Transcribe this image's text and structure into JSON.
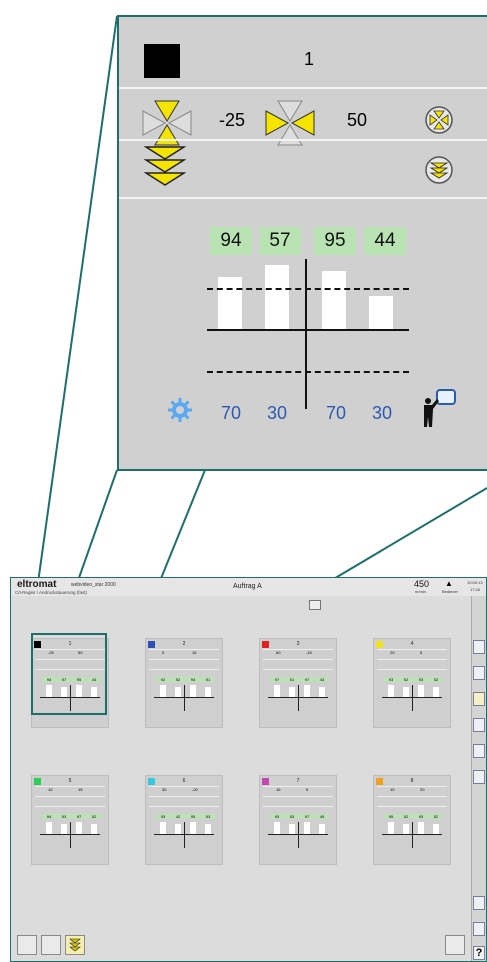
{
  "zoom": {
    "position_label": "1",
    "swatch_color": "#000000",
    "inlet": {
      "value_a": "-25",
      "value_b": "50"
    },
    "readings": [
      "94",
      "57",
      "95",
      "44"
    ],
    "bar_levels": [
      0.52,
      0.64,
      0.58,
      0.33
    ],
    "bottom_values": [
      "70",
      "30",
      "70",
      "30"
    ],
    "icons": [
      "valve-yellow-icon",
      "valve-pair-icon",
      "circle-valve-icon",
      "stacked-chevrons-icon",
      "circle-chevrons-icon",
      "gear-icon",
      "presenter-icon"
    ]
  },
  "app": {
    "logo": "eltromat",
    "logo_sub": "webvideo_star 2000",
    "breadcrumb": "C/I-Regler / Andruckstauerung (fast)",
    "job": "Auftrag A",
    "speed_value": "450",
    "speed_unit": "m/min",
    "user_label": "Bediener",
    "clock": "10:09:13",
    "clock2": "17:26"
  },
  "units": [
    {
      "label": "1",
      "color": "#000000",
      "a": "-25",
      "b": "50"
    },
    {
      "label": "2",
      "color": "#2e4fb8",
      "a": "0",
      "b": "15"
    },
    {
      "label": "3",
      "color": "#e02020",
      "a": "60",
      "b": "-15"
    },
    {
      "label": "4",
      "color": "#f2e21b",
      "a": "20",
      "b": "5"
    },
    {
      "label": "5",
      "color": "#2ccf55",
      "a": "10",
      "b": "15"
    },
    {
      "label": "6",
      "color": "#34c9e0",
      "a": "30",
      "b": "-20"
    },
    {
      "label": "7",
      "color": "#c247b2",
      "a": "15",
      "b": "5"
    },
    {
      "label": "8",
      "color": "#f2a020",
      "a": "10",
      "b": "20"
    }
  ],
  "unit_readings": [
    [
      "94",
      "57",
      "95",
      "44"
    ],
    [
      "92",
      "52",
      "94",
      "51"
    ],
    [
      "97",
      "51",
      "97",
      "43"
    ],
    [
      "93",
      "52",
      "93",
      "52"
    ],
    [
      "94",
      "53",
      "97",
      "52"
    ],
    [
      "93",
      "42",
      "95",
      "53"
    ],
    [
      "93",
      "53",
      "97",
      "49"
    ],
    [
      "95",
      "52",
      "93",
      "52"
    ]
  ],
  "help_label": "?"
}
